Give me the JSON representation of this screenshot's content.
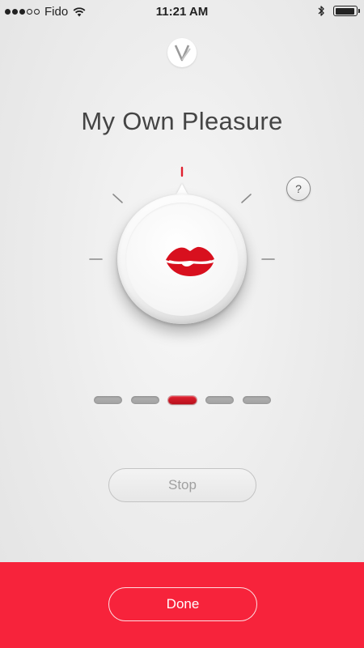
{
  "status_bar": {
    "carrier": "Fido",
    "time": "11:21 AM",
    "signal_bars_filled": 3,
    "signal_bars_total": 5,
    "battery_level": 1.0
  },
  "header": {
    "logo_icon": "v-logo-icon",
    "title": "My Own Pleasure"
  },
  "dial": {
    "icon": "lips-icon",
    "help_label": "?"
  },
  "intensity": {
    "levels_total": 5,
    "active_level": 3
  },
  "controls": {
    "stop_label": "Stop",
    "done_label": "Done"
  },
  "colors": {
    "accent": "#f7233b",
    "lips": "#d8101e",
    "active_segment": "#d41424",
    "inactive_segment": "#a8a8a8",
    "tick_active": "#e0202f",
    "tick_inactive": "#8a8a8a"
  }
}
